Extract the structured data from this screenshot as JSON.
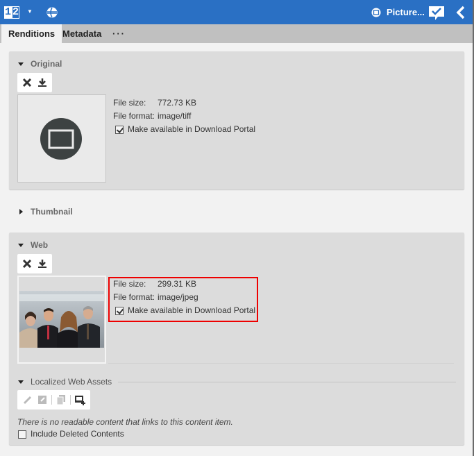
{
  "topbar": {
    "view_number_1": "1",
    "view_number_2": "2",
    "dropdown_icon": "caret-down-icon",
    "site_icon": "globe-icon",
    "document_type_icon": "picture-icon",
    "document_title": "Picture...",
    "approve_icon": "check-comment-icon",
    "collapse_icon": "chevron-left-icon"
  },
  "tabs": [
    {
      "label": "Renditions",
      "active": true
    },
    {
      "label": "Metadata",
      "active": false
    },
    {
      "label": "···",
      "active": false
    }
  ],
  "sections": {
    "original": {
      "title": "Original",
      "expanded": true,
      "toolbar": {
        "delete_icon": "close-icon",
        "download_icon": "download-icon"
      },
      "file_size_label": "File size:",
      "file_size": "772.73 KB",
      "file_format_label": "File format:",
      "file_format": "image/tiff",
      "download_portal_label": "Make available in Download Portal",
      "download_portal_checked": true,
      "preview_icon": "picture-placeholder-icon"
    },
    "thumbnail": {
      "title": "Thumbnail",
      "expanded": false
    },
    "web": {
      "title": "Web",
      "expanded": true,
      "toolbar": {
        "delete_icon": "close-icon",
        "download_icon": "download-icon"
      },
      "file_size_label": "File size:",
      "file_size": "299.31 KB",
      "file_format_label": "File format:",
      "file_format": "image/jpeg",
      "download_portal_label": "Make available in Download Portal",
      "download_portal_checked": true,
      "preview_alt": "Group photo of four business people"
    },
    "localized": {
      "title": "Localized Web Assets",
      "expanded": true,
      "toolbar": [
        "edit-icon",
        "open-icon",
        "copy-icon",
        "add-picture-icon"
      ],
      "empty_message": "There is no readable content that links to this content item.",
      "include_deleted_label": "Include Deleted Contents",
      "include_deleted_checked": false
    }
  },
  "colors": {
    "accent": "#2a70c4",
    "highlight": "#e00000",
    "panel": "#dcdcdc"
  }
}
